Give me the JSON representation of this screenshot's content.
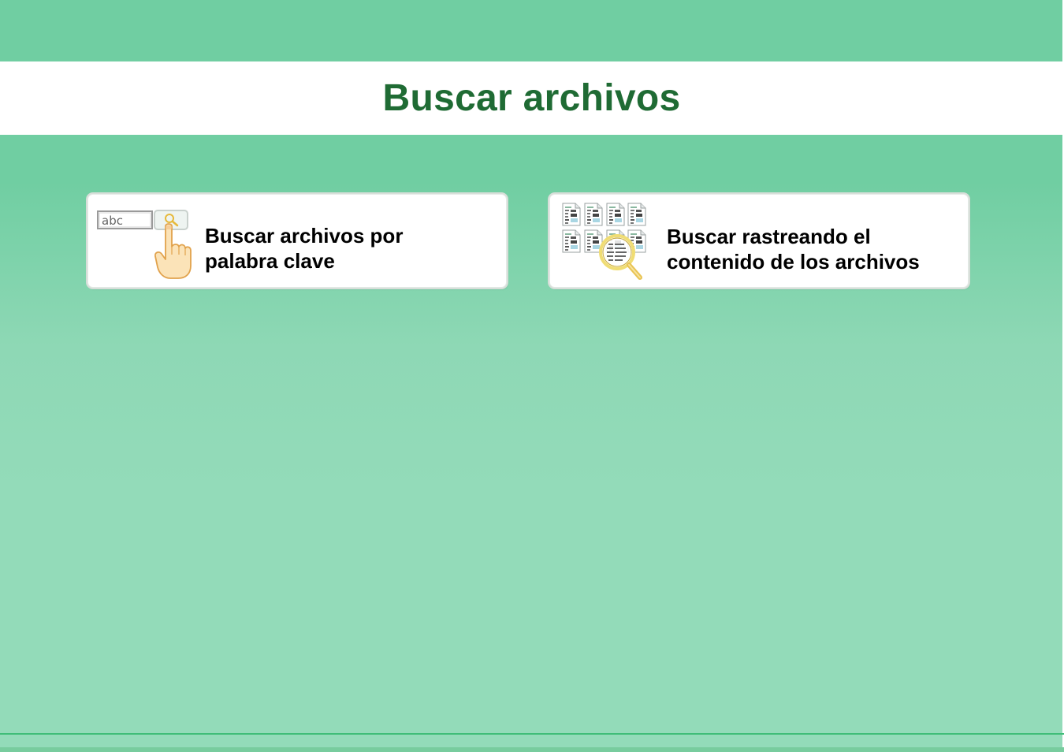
{
  "header": {
    "title": "Buscar archivos"
  },
  "cards": [
    {
      "label": "Buscar archivos por\npalabra clave",
      "icon": "keyword-search-icon",
      "icon_field_text": "abc"
    },
    {
      "label": "Buscar rastreando el\ncontenido de los archivos",
      "icon": "content-search-icon"
    }
  ],
  "colors": {
    "background": "#70cea2",
    "title": "#1f6b34",
    "card_background": "#ffffff",
    "label": "#000000"
  }
}
